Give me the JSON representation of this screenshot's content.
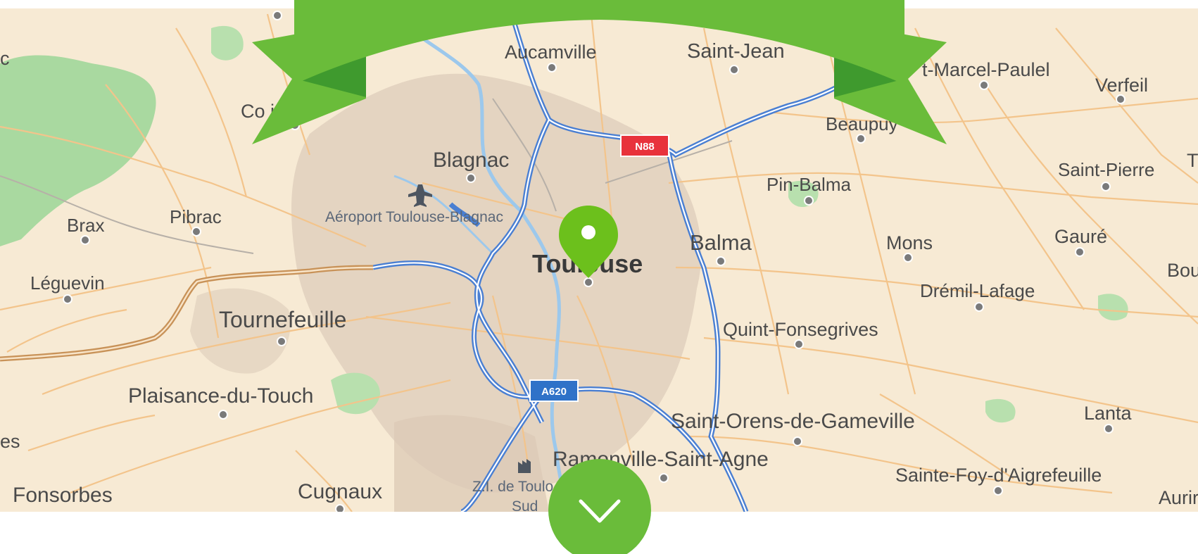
{
  "map": {
    "center_city": "Toulouse",
    "colors": {
      "land": "#f7ead4",
      "urban": "#e0d0bd",
      "green": "#a9d9a0",
      "water": "#9cc8ec",
      "minor_roads": "#f3c48b",
      "highway": "#4a7fd2",
      "banner": "#6abc3a",
      "banner_dark": "#3f9a2e",
      "marker": "#6cc01c"
    },
    "places": [
      {
        "key": "aucamville",
        "label": "Aucamville"
      },
      {
        "key": "saint_jean",
        "label": "Saint-Jean"
      },
      {
        "key": "marcel_paulel",
        "label": "t-Marcel-Paulel"
      },
      {
        "key": "verfeil",
        "label": "Verfeil"
      },
      {
        "key": "cornebarrieu",
        "label": "Co          ieu"
      },
      {
        "key": "beaupuy",
        "label": "Beaupuy"
      },
      {
        "key": "blagnac",
        "label": "Blagnac"
      },
      {
        "key": "saint_pierre",
        "label": "Saint-Pierre"
      },
      {
        "key": "pin_balma",
        "label": "Pin-Balma"
      },
      {
        "key": "airport",
        "label": "Aéroport Toulouse-Blagnac"
      },
      {
        "key": "brax",
        "label": "Brax"
      },
      {
        "key": "pibrac",
        "label": "Pibrac"
      },
      {
        "key": "balma",
        "label": "Balma"
      },
      {
        "key": "mons",
        "label": "Mons"
      },
      {
        "key": "gaure",
        "label": "Gauré"
      },
      {
        "key": "bou",
        "label": "Bou"
      },
      {
        "key": "toulouse",
        "label": "Toulouse"
      },
      {
        "key": "leguevin",
        "label": "Léguevin"
      },
      {
        "key": "dremil_lafage",
        "label": "Drémil-Lafage"
      },
      {
        "key": "tournefeuille",
        "label": "Tournefeuille"
      },
      {
        "key": "quint_fonsegrives",
        "label": "Quint-Fonsegrives"
      },
      {
        "key": "plaisance",
        "label": "Plaisance-du-Touch"
      },
      {
        "key": "saint_orens",
        "label": "Saint-Orens-de-Gameville"
      },
      {
        "key": "lanta",
        "label": "Lanta"
      },
      {
        "key": "es",
        "label": "es"
      },
      {
        "key": "ramonville",
        "label": "Ramonville-Saint-Agne"
      },
      {
        "key": "sainte_foy",
        "label": "Sainte-Foy-d'Aigrefeuille"
      },
      {
        "key": "fonsorbes",
        "label": "Fonsorbes"
      },
      {
        "key": "cugnaux",
        "label": "Cugnaux"
      },
      {
        "key": "zi_toulouse",
        "label": "Z.I. de Toulo"
      },
      {
        "key": "zi_sud",
        "label": "Sud"
      },
      {
        "key": "aurin",
        "label": "Aurir"
      },
      {
        "key": "edge_c",
        "label": "c"
      },
      {
        "key": "edge_t",
        "label": "T"
      }
    ],
    "road_shields": [
      {
        "key": "n88",
        "label": "N88",
        "color": "#e8323c"
      },
      {
        "key": "a620",
        "label": "A620",
        "color": "#2f72c8"
      }
    ]
  },
  "controls": {
    "scroll_down_label": "Scroll down",
    "scroll_down_icon": "chevron-down-icon",
    "marker_icon": "map-pin-icon",
    "airport_icon": "airplane-icon",
    "factory_icon": "factory-icon"
  }
}
